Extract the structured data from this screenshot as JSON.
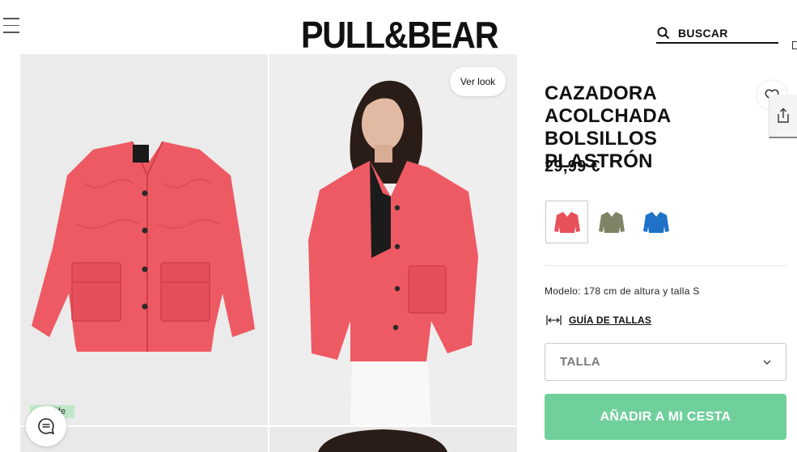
{
  "header": {
    "logo": "PULL&BEAR",
    "search_label": "BUSCAR",
    "menu_icon": "hamburger-menu-icon",
    "search_icon": "search-icon",
    "cart_icon": "shopping-bag-icon"
  },
  "gallery": {
    "ver_look_label": "Ver look",
    "tag_label": "life",
    "chat_icon": "chat-icon"
  },
  "product": {
    "title_lines": [
      "CAZADORA",
      "ACOLCHADA",
      "BOLSILLOS PLASTRÓN"
    ],
    "price": "29,99 €",
    "favorite_icon": "heart-icon",
    "share_icon": "share-icon",
    "colors": [
      {
        "name": "coral",
        "hex": "#e8505a",
        "selected": true
      },
      {
        "name": "khaki",
        "hex": "#7f8466",
        "selected": false
      },
      {
        "name": "blue",
        "hex": "#1f72c8",
        "selected": false
      }
    ],
    "model_info": "Modelo: 178 cm de altura y talla S",
    "size_guide_label": "GUÍA DE TALLAS",
    "size_select_label": "TALLA",
    "add_to_cart_label": "AÑADIR A MI CESTA"
  },
  "colors": {
    "accent_button": "#6fd09b",
    "jacket": "#ee5a63",
    "tag_background": "#bfe8c9"
  }
}
